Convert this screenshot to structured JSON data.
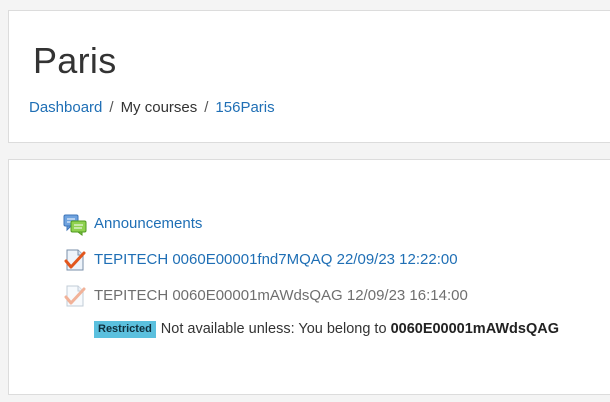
{
  "header": {
    "title": "Paris",
    "breadcrumb": [
      {
        "label": "Dashboard"
      },
      {
        "label": "My courses"
      },
      {
        "label": "156Paris"
      }
    ],
    "separator": "/"
  },
  "activities": [
    {
      "label": "Announcements",
      "icon": "forum-icon",
      "available": true
    },
    {
      "label": "TEPITECH 0060E00001fnd7MQAQ 22/09/23 12:22:00",
      "icon": "feedback-icon",
      "available": true
    },
    {
      "label": "TEPITECH 0060E00001mAWdsQAG 12/09/23 16:14:00",
      "icon": "feedback-icon",
      "available": false
    }
  ],
  "restriction": {
    "badge": "Restricted",
    "text": "Not available unless: You belong to",
    "group": "0060E00001mAWdsQAG"
  },
  "colors": {
    "link": "#1f6fb5",
    "badge": "#5bc0de",
    "dimmed": "#6f6f6f"
  }
}
